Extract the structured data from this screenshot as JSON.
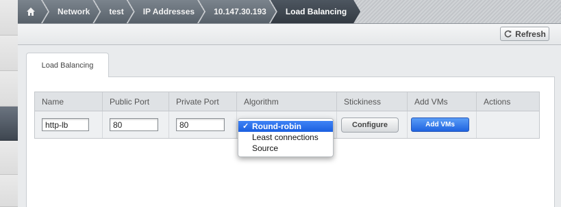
{
  "breadcrumb": {
    "items": [
      {
        "label": "Network"
      },
      {
        "label": "test"
      },
      {
        "label": "IP Addresses"
      },
      {
        "label": "10.147.30.193"
      },
      {
        "label": "Load Balancing"
      }
    ]
  },
  "toolbar": {
    "refresh_label": "Refresh"
  },
  "tab": {
    "label": "Load Balancing"
  },
  "table": {
    "columns": [
      "Name",
      "Public Port",
      "Private Port",
      "Algorithm",
      "Stickiness",
      "Add VMs",
      "Actions"
    ],
    "row": {
      "name": "http-lb",
      "public_port": "80",
      "private_port": "80",
      "configure_label": "Configure",
      "add_vms_label": "Add VMs"
    }
  },
  "algorithm_dropdown": {
    "options": [
      "Round-robin",
      "Least connections",
      "Source"
    ],
    "selected": "Round-robin",
    "check": "✓"
  },
  "colors": {
    "accent_blue": "#1f63e0",
    "breadcrumb_dark": "#333a42"
  }
}
